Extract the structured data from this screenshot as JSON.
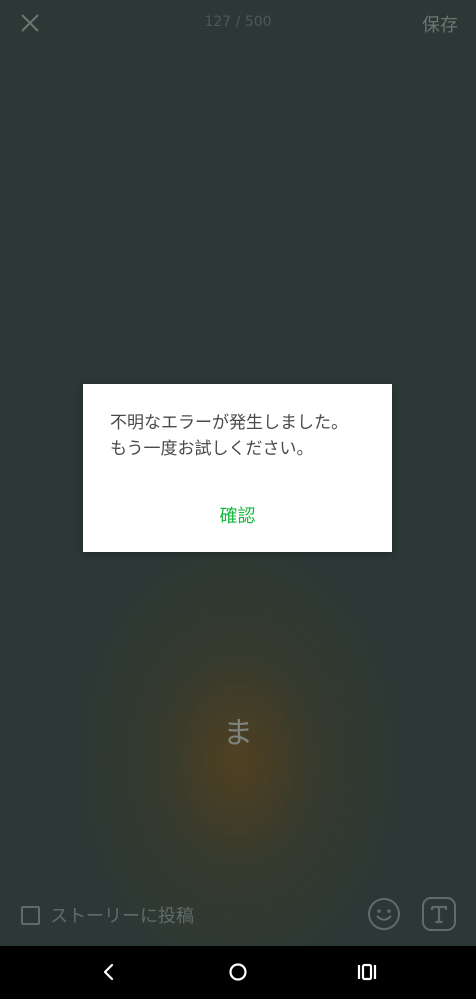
{
  "header": {
    "close_icon": "close-icon",
    "char_count": "127 / 500",
    "save_label": "保存"
  },
  "editor": {
    "story_text": "ま"
  },
  "footer": {
    "post_to_story_label": "ストーリーに投稿",
    "post_to_story_checked": false,
    "emoji_icon": "smiley-icon",
    "text_style_icon": "text-style-icon"
  },
  "dialog": {
    "message_line1": "不明なエラーが発生しました。",
    "message_line2": "もう一度お試しください。",
    "confirm_label": "確認",
    "accent_color": "#14b93c"
  },
  "system_nav": {
    "back_icon": "back-icon",
    "home_icon": "home-icon",
    "recents_icon": "recents-icon"
  }
}
